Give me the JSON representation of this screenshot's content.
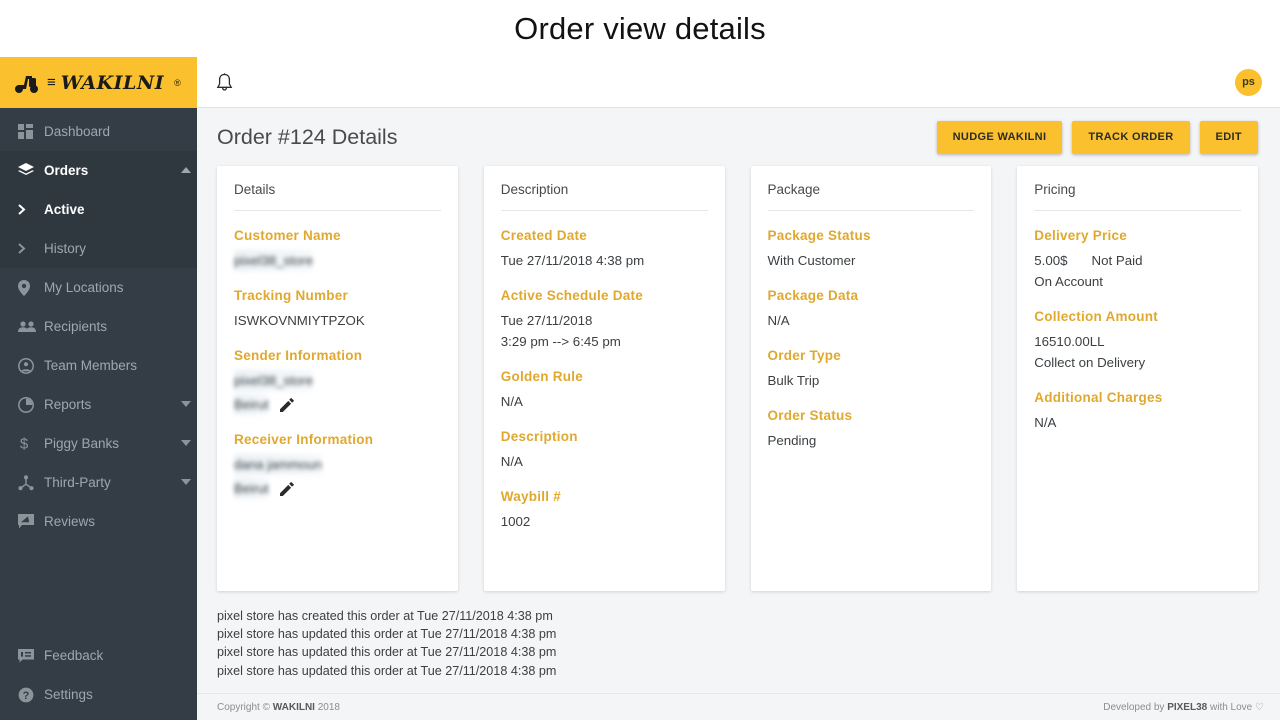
{
  "banner": {
    "title": "Order view details"
  },
  "brand": {
    "name": "WAKILNI",
    "registered": "®",
    "logo_icon": "scooter-icon"
  },
  "sidebar": {
    "items": [
      {
        "label": "Dashboard",
        "icon": "dashboard-icon"
      },
      {
        "label": "Orders",
        "icon": "layers-icon",
        "caret": "chevron-up-icon"
      },
      {
        "label": "Active",
        "icon": "chevron-right-icon"
      },
      {
        "label": "History",
        "icon": "chevron-right-icon"
      },
      {
        "label": "My Locations",
        "icon": "map-pin-icon"
      },
      {
        "label": "Recipients",
        "icon": "people-icon"
      },
      {
        "label": "Team Members",
        "icon": "account-circle-icon"
      },
      {
        "label": "Reports",
        "icon": "pie-chart-icon",
        "caret": "chevron-down-icon"
      },
      {
        "label": "Piggy Banks",
        "icon": "dollar-icon",
        "caret": "chevron-down-icon"
      },
      {
        "label": "Third-Party",
        "icon": "share-nodes-icon",
        "caret": "chevron-down-icon"
      },
      {
        "label": "Reviews",
        "icon": "feedback-square-icon"
      }
    ],
    "bottom_items": [
      {
        "label": "Feedback",
        "icon": "comment-icon"
      },
      {
        "label": "Settings",
        "icon": "help-circle-icon"
      }
    ]
  },
  "topbar": {
    "bell_icon": "notification-bell-icon",
    "avatar_initials": "ps"
  },
  "page": {
    "title": "Order #124 Details",
    "actions": [
      {
        "label": "NUDGE WAKILNI"
      },
      {
        "label": "TRACK ORDER"
      },
      {
        "label": "EDIT"
      }
    ]
  },
  "cards": {
    "details": {
      "title": "Details",
      "customer_name_label": "Customer Name",
      "customer_name_value": "pixel38_store",
      "tracking_number_label": "Tracking Number",
      "tracking_number_value": "ISWKOVNMIYTPZOK",
      "sender_label": "Sender Information",
      "sender_name": "pixel38_store",
      "sender_location": "Beirut",
      "receiver_label": "Receiver Information",
      "receiver_name": "dana jammoun",
      "receiver_location": "Beirut",
      "edit_icon": "pencil-icon"
    },
    "description": {
      "title": "Description",
      "created_date_label": "Created Date",
      "created_date_value": "Tue 27/11/2018 4:38 pm",
      "active_schedule_label": "Active Schedule Date",
      "active_schedule_date": "Tue 27/11/2018",
      "active_schedule_range": "3:29 pm --> 6:45 pm",
      "golden_rule_label": "Golden Rule",
      "golden_rule_value": "N/A",
      "description_label": "Description",
      "description_value": "N/A",
      "waybill_label": "Waybill #",
      "waybill_value": "1002"
    },
    "package": {
      "title": "Package",
      "package_status_label": "Package Status",
      "package_status_value": "With Customer",
      "package_data_label": "Package Data",
      "package_data_value": "N/A",
      "order_type_label": "Order Type",
      "order_type_value": "Bulk Trip",
      "order_status_label": "Order Status",
      "order_status_value": "Pending"
    },
    "pricing": {
      "title": "Pricing",
      "delivery_price_label": "Delivery Price",
      "delivery_price_amount": "5.00$",
      "delivery_price_paid_status": "Not Paid",
      "delivery_price_terms": "On Account",
      "collection_amount_label": "Collection Amount",
      "collection_amount_value": "16510.00LL",
      "collection_amount_terms": "Collect on Delivery",
      "additional_charges_label": "Additional Charges",
      "additional_charges_value": "N/A"
    }
  },
  "activity": {
    "lines": [
      "pixel store has created this order at Tue 27/11/2018 4:38 pm",
      "pixel store has updated this order at Tue 27/11/2018 4:38 pm",
      "pixel store has updated this order at Tue 27/11/2018 4:38 pm",
      "pixel store has updated this order at Tue 27/11/2018 4:38 pm"
    ]
  },
  "footer": {
    "copyright_prefix": "Copyright © ",
    "copyright_brand": "WAKILNI",
    "copyright_year": " 2018",
    "dev_prefix": "Developed by ",
    "dev_brand": "PIXEL38",
    "dev_suffix": " with Love ♡"
  },
  "colors": {
    "accent_yellow": "#fbc02d",
    "label_gold": "#e0a82e",
    "sidebar_bg": "#343d46",
    "content_bg": "#f4f5f6"
  }
}
